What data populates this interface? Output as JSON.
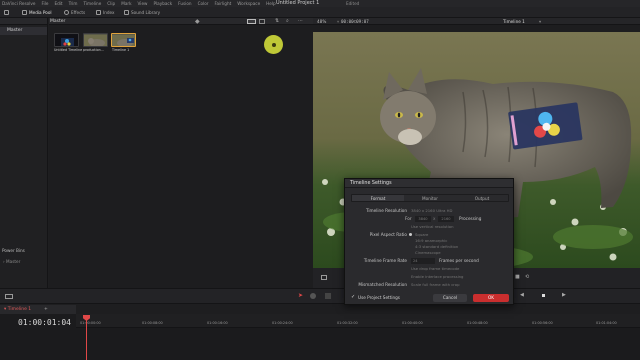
{
  "menubar": {
    "app": "DaVinci Resolve",
    "items": [
      "File",
      "Edit",
      "Trim",
      "Timeline",
      "Clip",
      "Mark",
      "View",
      "Playback",
      "Fusion",
      "Color",
      "Fairlight",
      "Workspace",
      "Help"
    ],
    "project_title": "Untitled Project 1",
    "status": "Edited"
  },
  "toolbar": {
    "media_pool": "Media Pool",
    "effects": "Effects",
    "index": "Index",
    "sound_library": "Sound Library"
  },
  "media_pool": {
    "bin_header": "Master",
    "master_bin": "Master",
    "power_bins": "Power Bins",
    "power_bins_master": "Master",
    "clips": [
      {
        "label": "Untitled Timeline"
      },
      {
        "label": "production..."
      },
      {
        "label": "Timeline 1"
      }
    ]
  },
  "viewer": {
    "zoom": "48%",
    "timecode": "00:00:09:07",
    "timeline_name": "Timeline 1"
  },
  "timeline": {
    "tab": "Timeline 1",
    "timecode": "01:00:01:04",
    "ruler": [
      "01:00:00:00",
      "01:00:08:00",
      "01:00:16:00",
      "01:00:24:00",
      "01:00:32:00",
      "01:00:40:00",
      "01:00:48:00",
      "01:00:56:00",
      "01:01:04:00"
    ]
  },
  "dialog": {
    "title": "Timeline Settings",
    "tabs": [
      "Format",
      "Monitor",
      "Output"
    ],
    "active_tab": "Format",
    "timeline_resolution_label": "Timeline Resolution",
    "timeline_resolution_value": "3840 x 2160 Ultra HD",
    "for_label": "For",
    "res_w": "3840",
    "res_x": "x",
    "res_h": "2160",
    "processing_label": "Processing",
    "vertical_resolution": "Use vertical resolution",
    "pixel_aspect_label": "Pixel Aspect Ratio",
    "pixel_options": [
      "Square",
      "16:9 anamorphic",
      "4:3 standard definition",
      "Cinemascope"
    ],
    "frame_rate_label": "Timeline Frame Rate",
    "frame_rate_value": "24",
    "frames_per_second": "Frames per second",
    "drop_frame": "Use drop frame timecode",
    "interlace": "Enable interlace processing",
    "mismatched_label": "Mismatched Resolution",
    "mismatched_value": "Scale full frame with crop",
    "use_project_settings": "Use Project Settings",
    "cancel": "Cancel",
    "ok": "OK"
  },
  "colors": {
    "accent_red": "#e04848",
    "ok_button": "#c92e2e",
    "cursor_highlight": "#dce63c"
  }
}
